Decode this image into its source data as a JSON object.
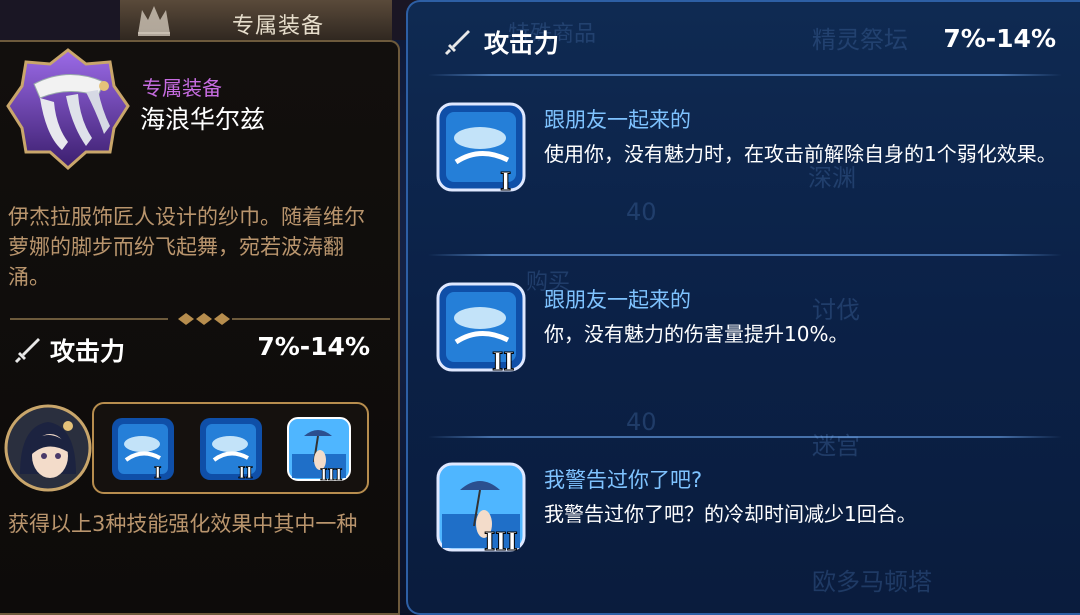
{
  "top_tab": {
    "label": "专属装备"
  },
  "equipment": {
    "type": "专属装备",
    "name": "海浪华尔兹",
    "description": "伊杰拉服饰匠人设计的纱巾。随着维尔萝娜的脚步而纷飞起舞，宛若波涛翻涌。",
    "stat": {
      "label": "攻击力",
      "value": "7%-14%",
      "icon": "sword-icon"
    },
    "skill_tiers": [
      "I",
      "II",
      "III"
    ],
    "footer": "获得以上3种技能强化效果中其中一种"
  },
  "background_menu": {
    "items": [
      "特殊商品",
      "精灵祭坛",
      "深渊",
      "40",
      "购买",
      "讨伐",
      "40",
      "迷宫",
      "欧多马顿塔"
    ]
  },
  "detail": {
    "stat": {
      "label": "攻击力",
      "value": "7%-14%",
      "icon": "sword-icon"
    },
    "options": [
      {
        "tier": "I",
        "title": "跟朋友一起来的",
        "desc": "使用你，没有魅力时，在攻击前解除自身的1个弱化效果。"
      },
      {
        "tier": "II",
        "title": "跟朋友一起来的",
        "desc": "你，没有魅力的伤害量提升10%。"
      },
      {
        "tier": "III",
        "title": "我警告过你了吧?",
        "desc": "我警告过你了吧？的冷却时间减少1回合。"
      }
    ]
  },
  "colors": {
    "equip_type": "#c66ce0",
    "desc_text": "#b9956d",
    "skill_title": "#7fc3ff",
    "gold_border": "#b78d4e",
    "panel_blue_border": "#2d5fa5"
  }
}
